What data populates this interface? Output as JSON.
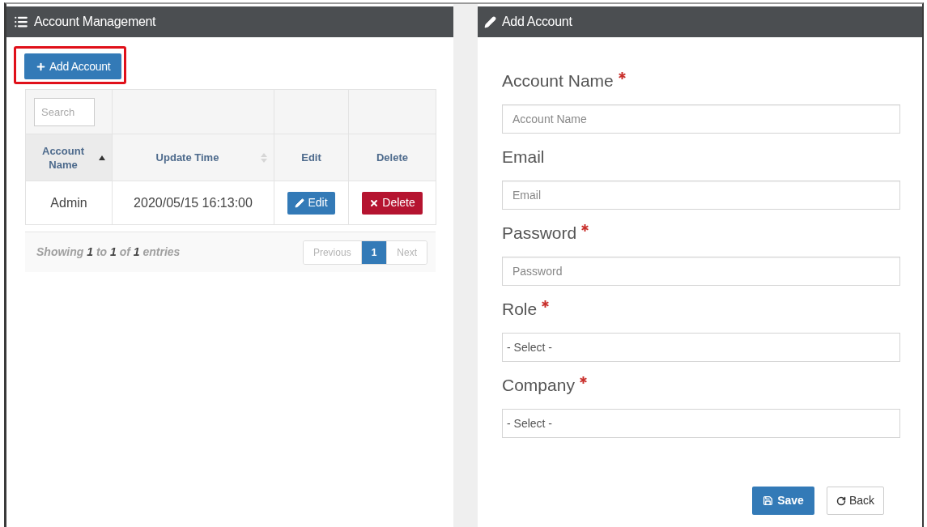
{
  "left_panel": {
    "title": "Account Management",
    "add_button": {
      "label": "Add Account",
      "highlighted": true
    },
    "table": {
      "search": {
        "placeholder": "Search"
      },
      "columns": [
        {
          "label": "Account Name",
          "sortable": true,
          "sorted": true
        },
        {
          "label": "Update Time",
          "sortable": true,
          "sorted": false
        },
        {
          "label": "Edit",
          "sortable": false,
          "sorted": false
        },
        {
          "label": "Delete",
          "sortable": false,
          "sorted": false
        }
      ],
      "rows": [
        {
          "cells": [
            {
              "kind": "text",
              "text": "Admin"
            },
            {
              "kind": "text",
              "text": "2020/05/15 16:13:00"
            },
            {
              "kind": "edit_button",
              "text": "Edit"
            },
            {
              "kind": "delete_button",
              "text": "Delete"
            }
          ]
        }
      ]
    },
    "footer": {
      "info": "Showing **1** to **1** of **1** entries",
      "pagination": [
        {
          "label": "Previous",
          "selected": false,
          "disabled": true
        },
        {
          "label": "1",
          "selected": true,
          "disabled": false
        },
        {
          "label": "Next",
          "selected": false,
          "disabled": true
        }
      ]
    }
  },
  "right_panel": {
    "title": "Add Account",
    "fields": [
      {
        "kind": "input",
        "label": "Account Name",
        "required": true,
        "placeholder": "Account Name"
      },
      {
        "kind": "input",
        "label": "Email",
        "required": false,
        "placeholder": "Email"
      },
      {
        "kind": "input",
        "label": "Password",
        "required": true,
        "placeholder": "Password"
      },
      {
        "kind": "select",
        "label": "Role",
        "required": true,
        "value": "- Select -"
      },
      {
        "kind": "select",
        "label": "Company",
        "required": true,
        "value": "- Select -"
      }
    ],
    "buttons": [
      {
        "kind": "primary",
        "label": "Save"
      },
      {
        "kind": "default",
        "label": "Back"
      }
    ]
  }
}
